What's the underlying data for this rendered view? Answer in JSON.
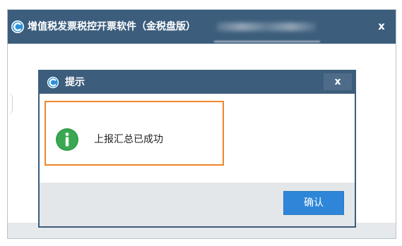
{
  "main_window": {
    "title": "增值税发票税控开票软件（金税盘版）",
    "close_label": "x"
  },
  "dialog": {
    "title": "提示",
    "close_label": "x",
    "message": "上报汇总已成功",
    "confirm_label": "确认"
  },
  "colors": {
    "titlebar": "#3c5d7c",
    "highlight_border": "#f0862a",
    "info_icon": "#2e9a46",
    "confirm_button": "#2f86d8"
  },
  "icons": {
    "app": "app-logo-icon",
    "info": "info-icon",
    "close": "close-icon"
  }
}
